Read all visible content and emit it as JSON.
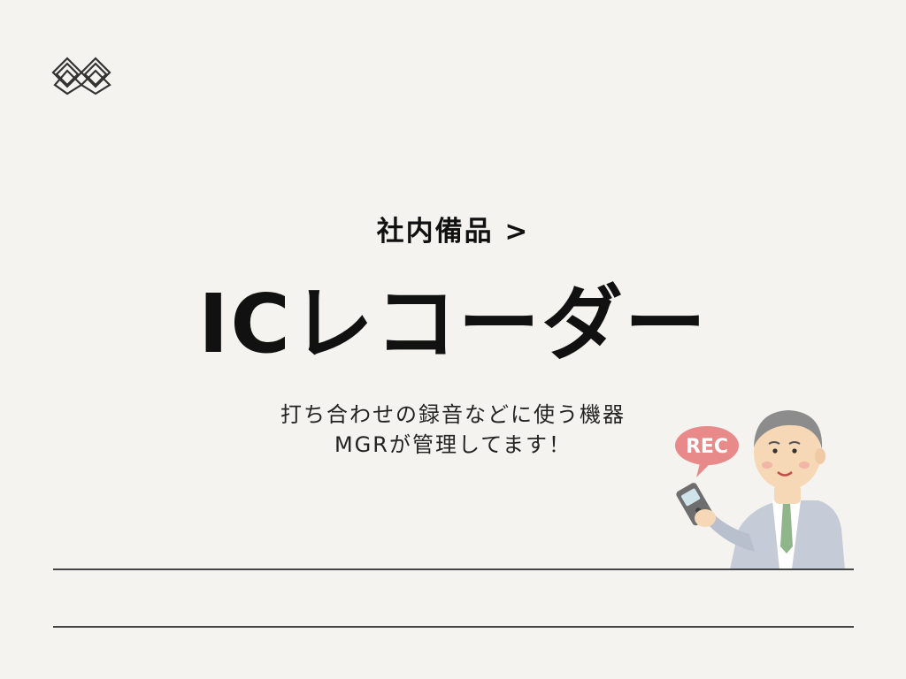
{
  "category": {
    "label": "社内備品 >"
  },
  "title": "ICレコーダー",
  "description": {
    "line1": "打ち合わせの録音などに使う機器",
    "line2": "MGRが管理してます！"
  },
  "illustration": {
    "badge_text": "REC"
  },
  "colors": {
    "background": "#f4f3ef",
    "text": "#111111",
    "rec_badge": "#e88a8a",
    "suit": "#c5ccd8",
    "tie": "#8fb58a"
  }
}
